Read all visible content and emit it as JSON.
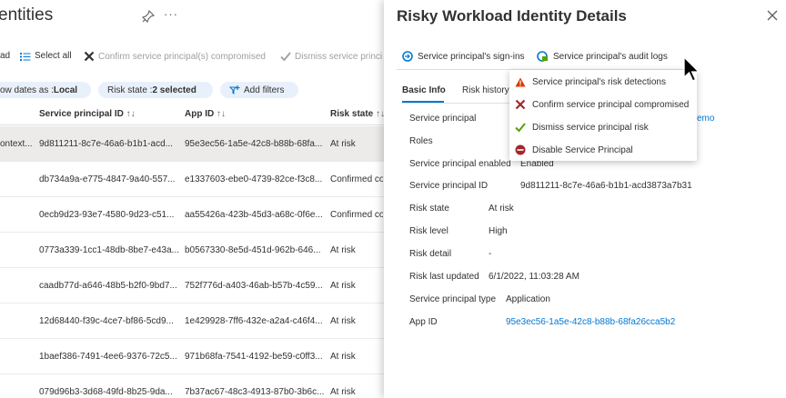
{
  "page": {
    "title": "entities",
    "commands": {
      "download_fragment": "ad",
      "select_all": "Select all",
      "confirm_compromised": "Confirm service principal(s) compromised",
      "dismiss_fragment": "Dismiss service princi"
    },
    "filters": {
      "show_dates_prefix": "ow dates as : ",
      "show_dates_value": "Local",
      "risk_state_prefix": "Risk state : ",
      "risk_state_value": "2 selected",
      "add_filters": "Add filters"
    },
    "columns": {
      "service_principal_id": "Service principal ID",
      "app_id": "App ID",
      "risk_state": "Risk state",
      "sort_glyph": "↑↓"
    },
    "rows": [
      {
        "name": "ontext...",
        "spid": "9d811211-8c7e-46a6-b1b1-acd...",
        "appid": "95e3ec56-1a5e-42c8-b88b-68fa...",
        "state": "At risk"
      },
      {
        "name": "",
        "spid": "db734a9a-e775-4847-9a40-557...",
        "appid": "e1337603-ebe0-4739-82ce-f3c8...",
        "state": "Confirmed co"
      },
      {
        "name": "",
        "spid": "0ecb9d23-93e7-4580-9d23-c51...",
        "appid": "aa55426a-423b-45d3-a68c-0f6e...",
        "state": "Confirmed co"
      },
      {
        "name": "",
        "spid": "0773a339-1cc1-48db-8be7-e43a...",
        "appid": "b0567330-8e5d-451d-962b-646...",
        "state": "At risk"
      },
      {
        "name": "",
        "spid": "caadb77d-a646-48b5-b2f0-9bd7...",
        "appid": "752f776d-a403-46ab-b57b-4c59...",
        "state": "At risk"
      },
      {
        "name": "",
        "spid": "12d68440-f39c-4ce7-bf86-5cd9...",
        "appid": "1e429928-7ff6-432e-a2a4-c46f4...",
        "state": "At risk"
      },
      {
        "name": "",
        "spid": "1baef386-7491-4ee6-9376-72c5...",
        "appid": "971b68fa-7541-4192-be59-c0ff3...",
        "state": "At risk"
      },
      {
        "name": "",
        "spid": "079d96b3-3d68-49fd-8b25-9da...",
        "appid": "7b37ac67-48c3-4913-87b0-3b6c...",
        "state": "At risk"
      }
    ]
  },
  "panel": {
    "title": "Risky Workload Identity Details",
    "toolbar": {
      "signins": "Service principal's sign-ins",
      "audit_logs": "Service principal's audit logs"
    },
    "tabs": {
      "basic_info": "Basic Info",
      "risk_history": "Risk history"
    },
    "menu": {
      "risk_detections": "Service principal's risk detections",
      "confirm": "Confirm service principal compromised",
      "dismiss": "Dismiss service principal risk",
      "disable": "Disable Service Principal"
    },
    "props": {
      "sp_label": "Service principal",
      "sp_value_fragment": "emo",
      "roles_label": "Roles",
      "enabled_label": "Service principal enabled",
      "enabled_value": "Enabled",
      "spid_label": "Service principal ID",
      "spid_value": "9d811211-8c7e-46a6-b1b1-acd3873a7b31",
      "state_label": "Risk state",
      "state_value": "At risk",
      "level_label": "Risk level",
      "level_value": "High",
      "detail_label": "Risk detail",
      "detail_value": "-",
      "updated_label": "Risk last updated",
      "updated_value": "6/1/2022, 11:03:28 AM",
      "type_label": "Service principal type",
      "type_value": "Application",
      "appid_label": "App ID",
      "appid_value": "95e3ec56-1a5e-42c8-b88b-68fa26cca5b2"
    }
  },
  "colors": {
    "accent": "#0078d4",
    "warning": "#d83b01",
    "danger": "#a4262c",
    "success": "#107c10"
  },
  "icons": {
    "pin": "pin-icon",
    "more": "more-icon",
    "close": "close-icon",
    "select_all": "list-icon",
    "confirm": "x-icon",
    "dismiss": "check-icon",
    "add_filters": "filter-add-icon",
    "signins": "signin-icon",
    "audit_logs": "audit-log-icon",
    "warning": "warning-icon",
    "disable": "disable-icon"
  }
}
